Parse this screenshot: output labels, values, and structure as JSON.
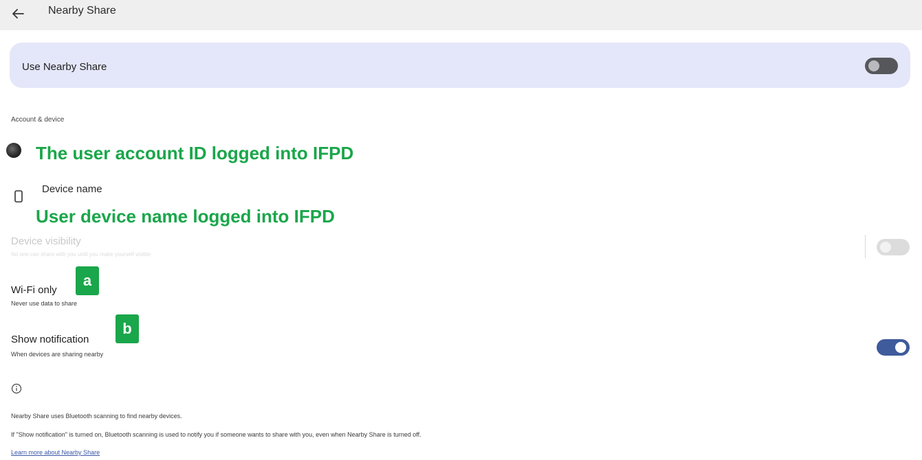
{
  "topbar": {
    "title": "Nearby Share",
    "back_icon": "arrow-back-icon"
  },
  "main_toggle": {
    "label": "Use Nearby Share",
    "state": "off"
  },
  "section": {
    "header": "Account & device"
  },
  "account": {
    "annotation": "The user account ID logged into IFPD"
  },
  "device": {
    "label": "Device name",
    "annotation": "User device name logged into IFPD",
    "icon": "phone-icon"
  },
  "visibility": {
    "title": "Device visibility",
    "subtitle": "No one can share with you until you make yourself visible",
    "state": "off"
  },
  "wifi": {
    "title": "Wi-Fi only",
    "subtitle": "Never use data to share",
    "badge": "a"
  },
  "notification": {
    "title": "Show notification",
    "subtitle": "When devices are sharing nearby",
    "badge": "b",
    "state": "on"
  },
  "info": {
    "icon": "info-icon",
    "line1": "Nearby Share uses Bluetooth scanning to find nearby devices.",
    "line2": "If \"Show notification\" is turned on, Bluetooth scanning is used to notify you if someone wants to share with you, even when Nearby Share is turned off.",
    "link": "Learn more about Nearby Share"
  },
  "colors": {
    "annotation_green": "#1aa64a",
    "toggle_on": "#3f5b9c",
    "card_bg": "#e4e6f9"
  }
}
